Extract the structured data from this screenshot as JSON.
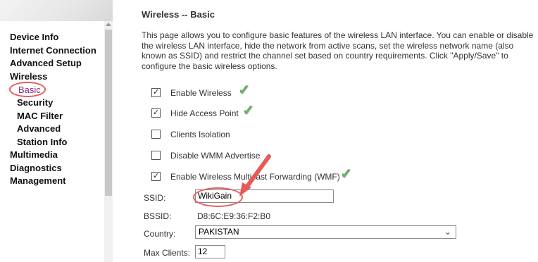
{
  "sidebar": {
    "items": [
      {
        "label": "Device Info",
        "sub": false
      },
      {
        "label": "Internet Connection",
        "sub": false
      },
      {
        "label": "Advanced Setup",
        "sub": false
      },
      {
        "label": "Wireless",
        "sub": false
      },
      {
        "label": "Basic",
        "sub": true,
        "selected": true
      },
      {
        "label": "Security",
        "sub": true
      },
      {
        "label": "MAC Filter",
        "sub": true
      },
      {
        "label": "Advanced",
        "sub": true
      },
      {
        "label": "Station Info",
        "sub": true
      },
      {
        "label": "Multimedia",
        "sub": false
      },
      {
        "label": "Diagnostics",
        "sub": false
      },
      {
        "label": "Management",
        "sub": false
      }
    ]
  },
  "main": {
    "title": "Wireless -- Basic",
    "description": "This page allows you to configure basic features of the wireless LAN interface. You can enable or disable the wireless LAN interface, hide the network from active scans, set the wireless network name (also known as SSID) and restrict the channel set based on country requirements. Click \"Apply/Save\" to configure the basic wireless options.",
    "options": [
      {
        "label": "Enable Wireless",
        "checked": true
      },
      {
        "label": "Hide Access Point",
        "checked": true
      },
      {
        "label": "Clients Isolation",
        "checked": false
      },
      {
        "label": "Disable WMM Advertise",
        "checked": false
      },
      {
        "label": "Enable Wireless Multicast Forwarding (WMF)",
        "checked": true
      }
    ],
    "ssid": {
      "label": "SSID:",
      "value": "WikiGain"
    },
    "bssid": {
      "label": "BSSID:",
      "value": "D8:6C:E9:36:F2:B0"
    },
    "country": {
      "label": "Country:",
      "value": "PAKISTAN"
    },
    "max_clients": {
      "label": "Max Clients:",
      "value": "12"
    }
  },
  "colors": {
    "annotation": "#e85a5a",
    "tick": "#5cb85c",
    "selected_nav": "#8a2a7a"
  },
  "icons": {
    "check_mark": "✓",
    "chevron": "⌄"
  }
}
